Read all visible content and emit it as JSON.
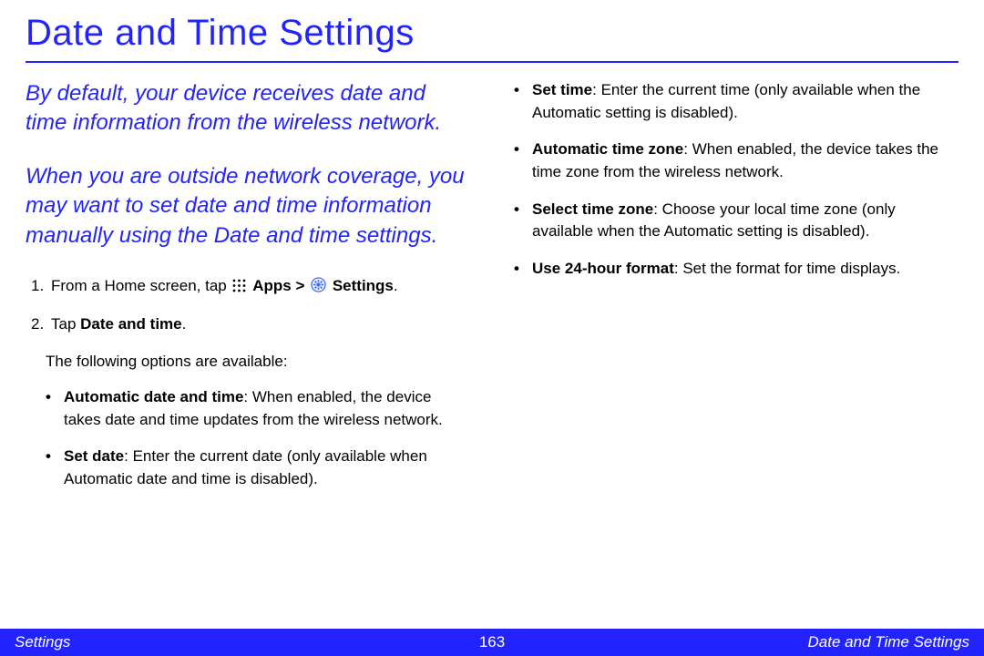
{
  "title": "Date and Time Settings",
  "intro": {
    "p1": "By default, your device receives date and time information from the wireless network.",
    "p2": "When you are outside network coverage, you may want to set date and time information manually using the Date and time settings."
  },
  "steps": {
    "s1": {
      "num": "1.",
      "pre": "From a Home screen, tap ",
      "apps": "Apps",
      "gt": " > ",
      "settings": "Settings",
      "post": "."
    },
    "s2": {
      "num": "2.",
      "pre": "Tap ",
      "bold": "Date and time",
      "post": "."
    }
  },
  "options_intro": "The following options are available:",
  "bullets_left": {
    "b1": {
      "bold": "Automatic date and time",
      "text": ": When enabled, the device takes date and time updates from the wireless network."
    },
    "b2": {
      "bold": "Set date",
      "text": ": Enter the current date (only available when Automatic date and time is disabled)."
    }
  },
  "bullets_right": {
    "b1": {
      "bold": "Set time",
      "text": ": Enter the current time (only available when the Automatic setting is disabled)."
    },
    "b2": {
      "bold": "Automatic time zone",
      "text": ": When enabled, the device takes the time zone from the wireless network."
    },
    "b3": {
      "bold": "Select time zone",
      "text": ": Choose your local time zone (only available when the Automatic setting is disabled)."
    },
    "b4": {
      "bold": "Use 24-hour format",
      "text": ": Set the format for time displays."
    }
  },
  "footer": {
    "left": "Settings",
    "center": "163",
    "right": "Date and Time Settings"
  }
}
